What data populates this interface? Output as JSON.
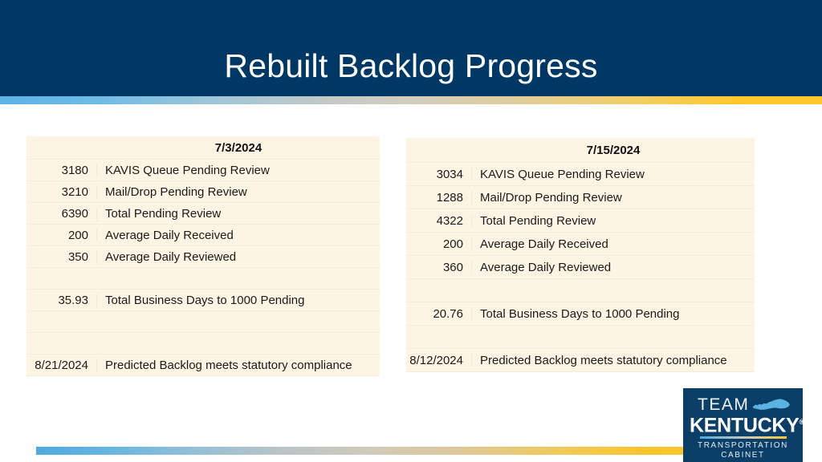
{
  "header": {
    "title": "Rebuilt Backlog Progress",
    "band_color": "#003865",
    "accent_gradient_from": "#5bb3e4",
    "accent_gradient_to": "#ffc72c"
  },
  "tables": {
    "left": {
      "name": "backlog-table-july-3",
      "date_header": "7/3/2024",
      "rows": [
        {
          "value": "3180",
          "label": "KAVIS Queue Pending Review"
        },
        {
          "value": "3210",
          "label": "Mail/Drop Pending Review"
        },
        {
          "value": "6390",
          "label": "Total Pending Review"
        },
        {
          "value": "200",
          "label": "Average Daily Received"
        },
        {
          "value": "350",
          "label": "Average Daily Reviewed"
        },
        {
          "value": "",
          "label": ""
        },
        {
          "value": "35.93",
          "label": "Total Business Days to 1000 Pending"
        },
        {
          "value": "",
          "label": ""
        },
        {
          "value": "",
          "label": ""
        },
        {
          "value": "8/21/2024",
          "label": "Predicted Backlog meets statutory compliance"
        }
      ]
    },
    "right": {
      "name": "backlog-table-july-15",
      "date_header": "7/15/2024",
      "rows": [
        {
          "value": "3034",
          "label": "KAVIS Queue Pending Review"
        },
        {
          "value": "1288",
          "label": "Mail/Drop Pending Review"
        },
        {
          "value": "4322",
          "label": "Total Pending Review"
        },
        {
          "value": "200",
          "label": "Average Daily Received"
        },
        {
          "value": "360",
          "label": "Average Daily Reviewed"
        },
        {
          "value": "",
          "label": ""
        },
        {
          "value": "20.76",
          "label": "Total Business Days to 1000 Pending"
        },
        {
          "value": "",
          "label": ""
        },
        {
          "value": "8/12/2024",
          "label": "Predicted Backlog meets statutory compliance"
        }
      ]
    }
  },
  "logo": {
    "team": "TEAM",
    "kentucky": "KENTUCKY",
    "registered": "®",
    "sub_line1": "TRANSPORTATION",
    "sub_line2": "CABINET",
    "background": "#0c3f68"
  }
}
